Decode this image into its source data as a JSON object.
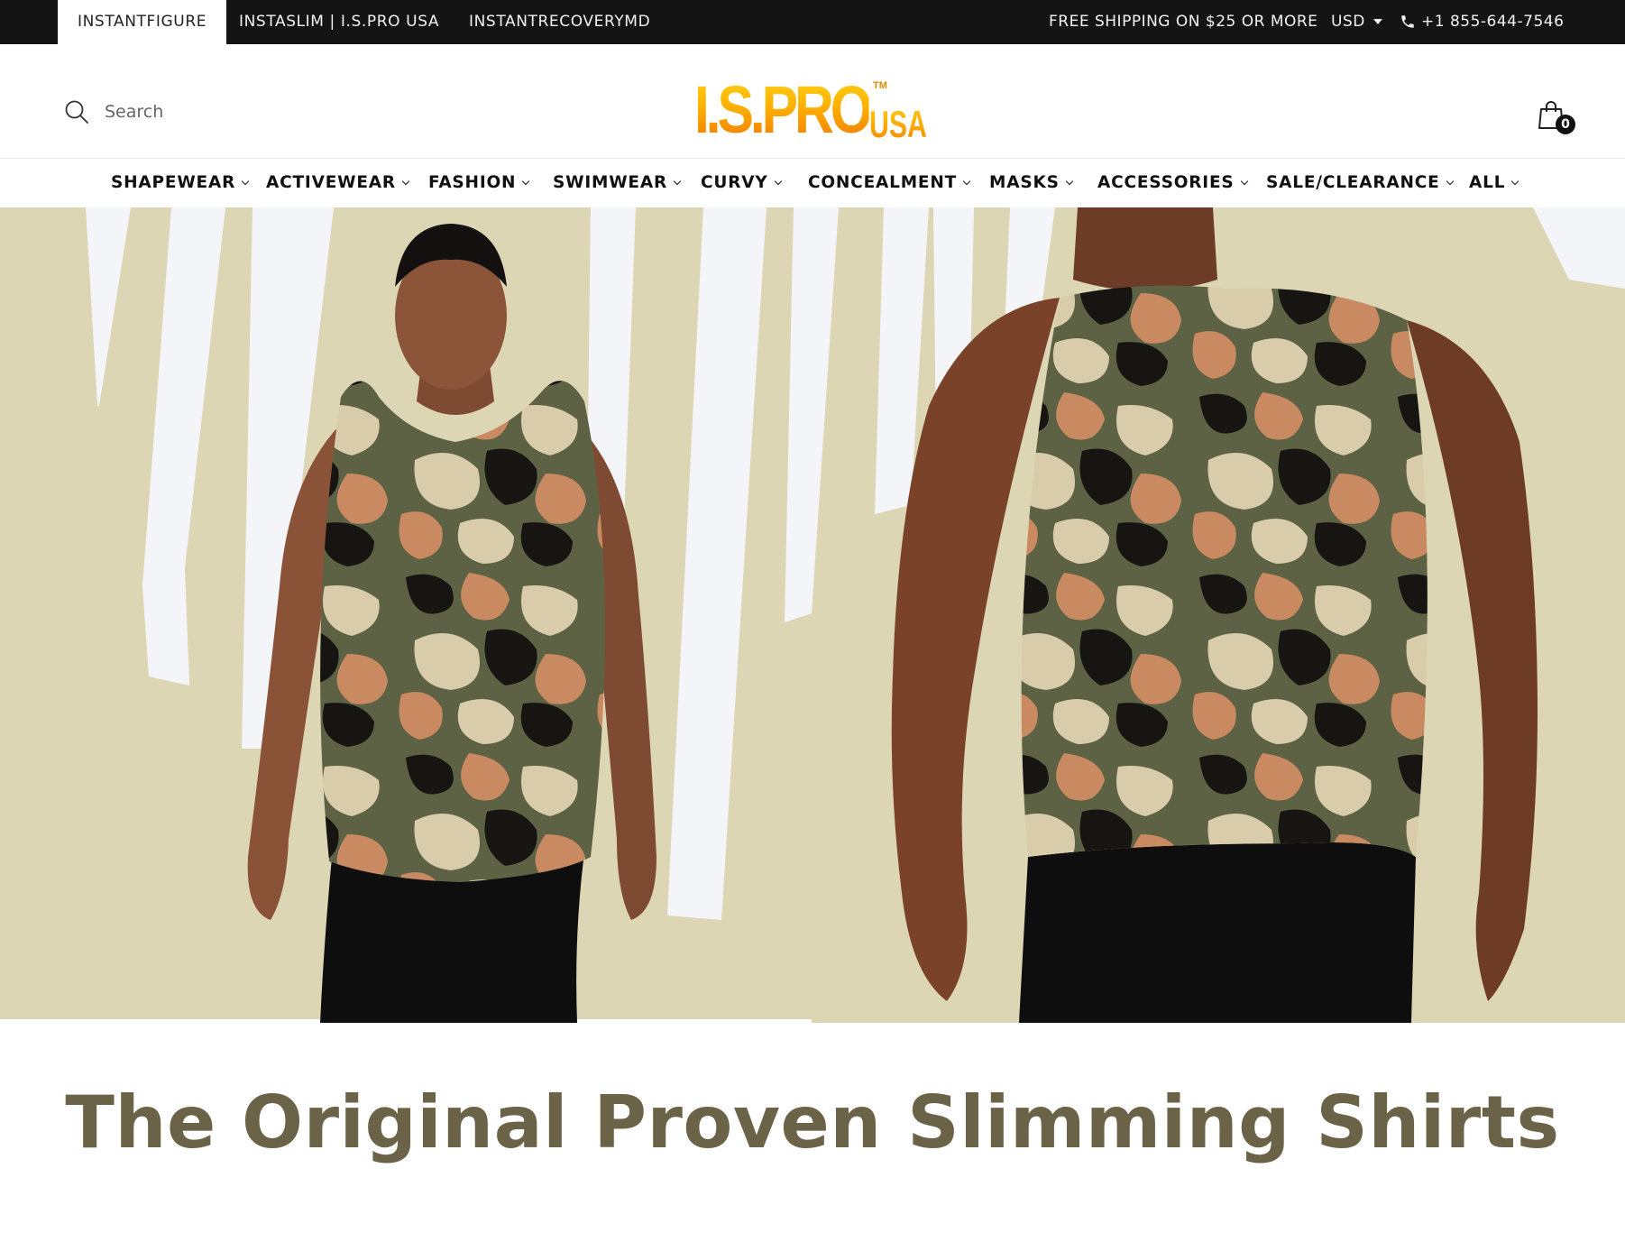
{
  "topbar": {
    "site_tabs": [
      {
        "label": "INSTANTFIGURE",
        "active": true
      },
      {
        "label": "INSTASLIM | I.S.PRO USA",
        "active": false
      },
      {
        "label": "INSTANTRECOVERYMD",
        "active": false
      }
    ],
    "shipping_text": "FREE SHIPPING ON $25 OR MORE",
    "currency": "USD",
    "phone": "+1 855-644-7546",
    "phone_icon": "phone-icon",
    "background": "#141414"
  },
  "header": {
    "search": {
      "placeholder": "Search",
      "icon": "search-icon"
    },
    "logo": {
      "main": "I.S.PRO",
      "tm": "TM",
      "usa": "USA"
    },
    "cart": {
      "count": "0",
      "icon": "shopping-bag-icon"
    }
  },
  "nav": {
    "items": [
      {
        "label": "SHAPEWEAR"
      },
      {
        "label": "ACTIVEWEAR"
      },
      {
        "label": "FASHION"
      },
      {
        "label": "SWIMWEAR"
      },
      {
        "label": "CURVY"
      },
      {
        "label": "CONCEALMENT"
      },
      {
        "label": "MASKS"
      },
      {
        "label": "ACCESSORIES"
      },
      {
        "label": "SALE/CLEARANCE"
      },
      {
        "label": "ALL"
      }
    ],
    "dropdown_icon": "chevron-down-icon"
  },
  "hero": {
    "background_color": "#ddd6b5",
    "stripe_color": "#f4f5f8",
    "camo_colors": [
      "#5e6244",
      "#161512",
      "#c98a62",
      "#d9ccaa"
    ]
  },
  "headline": {
    "text": "The Original Proven Slimming Shirts",
    "color": "#6b6347"
  }
}
